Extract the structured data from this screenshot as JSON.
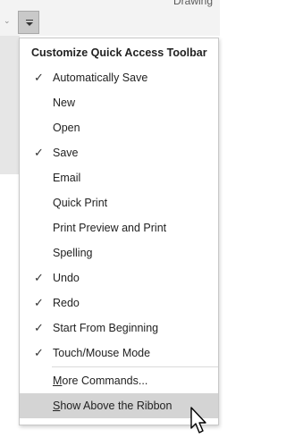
{
  "topbar": {
    "right_label": "Drawing"
  },
  "menu": {
    "title": "Customize Quick Access Toolbar",
    "items": [
      {
        "label": "Automatically Save",
        "checked": true
      },
      {
        "label": "New",
        "checked": false
      },
      {
        "label": "Open",
        "checked": false
      },
      {
        "label": "Save",
        "checked": true
      },
      {
        "label": "Email",
        "checked": false
      },
      {
        "label": "Quick Print",
        "checked": false
      },
      {
        "label": "Print Preview and Print",
        "checked": false
      },
      {
        "label": "Spelling",
        "checked": false
      },
      {
        "label": "Undo",
        "checked": true
      },
      {
        "label": "Redo",
        "checked": true
      },
      {
        "label": "Start From Beginning",
        "checked": true
      },
      {
        "label": "Touch/Mouse Mode",
        "checked": true
      }
    ],
    "more_commands": {
      "first": "M",
      "rest": "ore Commands..."
    },
    "show_above": {
      "first": "S",
      "rest": "how Above the Ribbon"
    },
    "check_glyph": "✓"
  }
}
